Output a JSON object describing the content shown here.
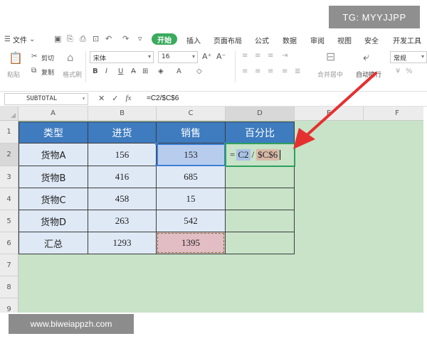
{
  "watermark": {
    "top": "TG: MYYJJPP",
    "bottom": "www.biweiappzh.com"
  },
  "menu": {
    "file": "文件",
    "tabs": [
      "开始",
      "插入",
      "页面布局",
      "公式",
      "数据",
      "审阅",
      "视图",
      "安全",
      "开发工具"
    ],
    "active_tab_color": "#3aaa5c"
  },
  "toolbar": {
    "paste": "粘贴",
    "cut": "剪切",
    "copy": "复制",
    "format_painter": "格式刷",
    "font_name": "宋体",
    "font_size": "16",
    "merge_center": "合并居中",
    "wrap_text": "自动换行",
    "number_format": "常规"
  },
  "formula_bar": {
    "name_box": "SUBTOTAL",
    "fx": "fx",
    "formula": "=C2/$C$6"
  },
  "grid": {
    "columns": [
      "A",
      "B",
      "C",
      "D",
      "E",
      "F"
    ],
    "rows": [
      "1",
      "2",
      "3",
      "4",
      "5",
      "6",
      "7",
      "8",
      "9"
    ],
    "header_row": [
      "类型",
      "进货",
      "销售",
      "百分比"
    ],
    "data": [
      {
        "type": "货物A",
        "purchase": "156",
        "sales": "153"
      },
      {
        "type": "货物B",
        "purchase": "416",
        "sales": "685"
      },
      {
        "type": "货物C",
        "purchase": "458",
        "sales": "15"
      },
      {
        "type": "货物D",
        "purchase": "263",
        "sales": "542"
      },
      {
        "type": "汇总",
        "purchase": "1293",
        "sales": "1395"
      }
    ],
    "editing": {
      "eq": "=",
      "ref1": "C2",
      "op": "/",
      "ref2": "$C$6"
    },
    "colors": {
      "header": "#3e7bbf",
      "body": "#dfe9f6",
      "sheet": "#c8e3c8",
      "ref": "#b8cdee",
      "total": "#e2bdc4",
      "arrow": "#e53030"
    }
  }
}
